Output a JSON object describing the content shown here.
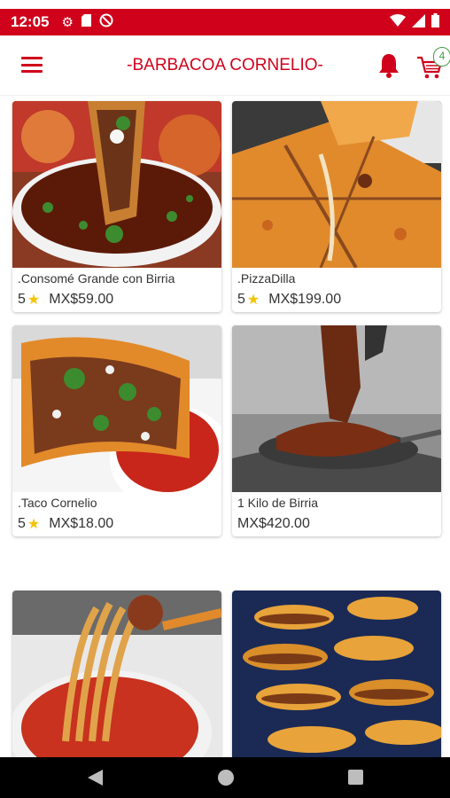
{
  "status_bar": {
    "time": "12:05"
  },
  "app_bar": {
    "title": "-BARBACOA CORNELIO-",
    "cart_count": "4",
    "accent_color": "#d0021b"
  },
  "products": [
    {
      "name": ".Consomé Grande con Birria",
      "rating": "5",
      "price": "MX$59.00"
    },
    {
      "name": ".PizzaDilla",
      "rating": "5",
      "price": "MX$199.00"
    },
    {
      "name": ".Taco Cornelio",
      "rating": "5",
      "price": "MX$18.00"
    },
    {
      "name": "1 Kilo de Birria",
      "rating": "",
      "price": "MX$420.00"
    },
    {
      "name": "",
      "rating": "",
      "price": ""
    },
    {
      "name": "",
      "rating": "",
      "price": ""
    }
  ],
  "icons": {
    "status": [
      "gear-icon",
      "sd-card-icon",
      "do-not-disturb-icon",
      "wifi-icon",
      "signal-icon",
      "battery-icon"
    ],
    "app_bar": [
      "menu-icon",
      "bell-icon",
      "cart-icon"
    ],
    "nav": [
      "back-icon",
      "home-icon",
      "recents-icon"
    ]
  }
}
